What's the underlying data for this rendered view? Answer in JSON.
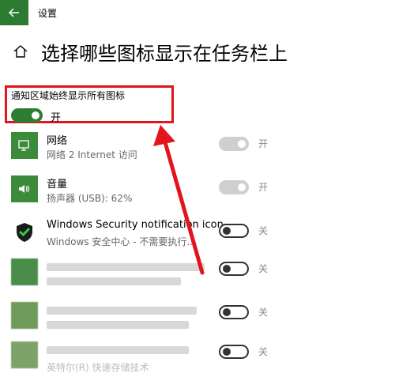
{
  "window": {
    "title": "设置"
  },
  "page": {
    "title": "选择哪些图标显示在任务栏上"
  },
  "always_show": {
    "label": "通知区域始终显示所有图标",
    "state": "开"
  },
  "apps": [
    {
      "name": "网络",
      "sub": "网络 2 Internet 访问",
      "state": "开",
      "icon": "network-icon"
    },
    {
      "name": "音量",
      "sub": "扬声器 (USB): 62%",
      "state": "开",
      "icon": "volume-icon"
    },
    {
      "name": "Windows Security notification icon",
      "sub": "Windows 安全中心 - 不需要执行...",
      "state": "关",
      "icon": "shield-icon"
    },
    {
      "name": "",
      "sub": "",
      "state": "关",
      "icon": "blurred-app-icon"
    },
    {
      "name": "",
      "sub": "",
      "state": "关",
      "icon": "blurred-app-icon"
    },
    {
      "name": "",
      "sub": "英特尔(R) 快速存储技术",
      "state": "关",
      "icon": "blurred-app-icon"
    }
  ],
  "colors": {
    "accent": "#2b7a2f",
    "highlight": "#e2141c"
  }
}
